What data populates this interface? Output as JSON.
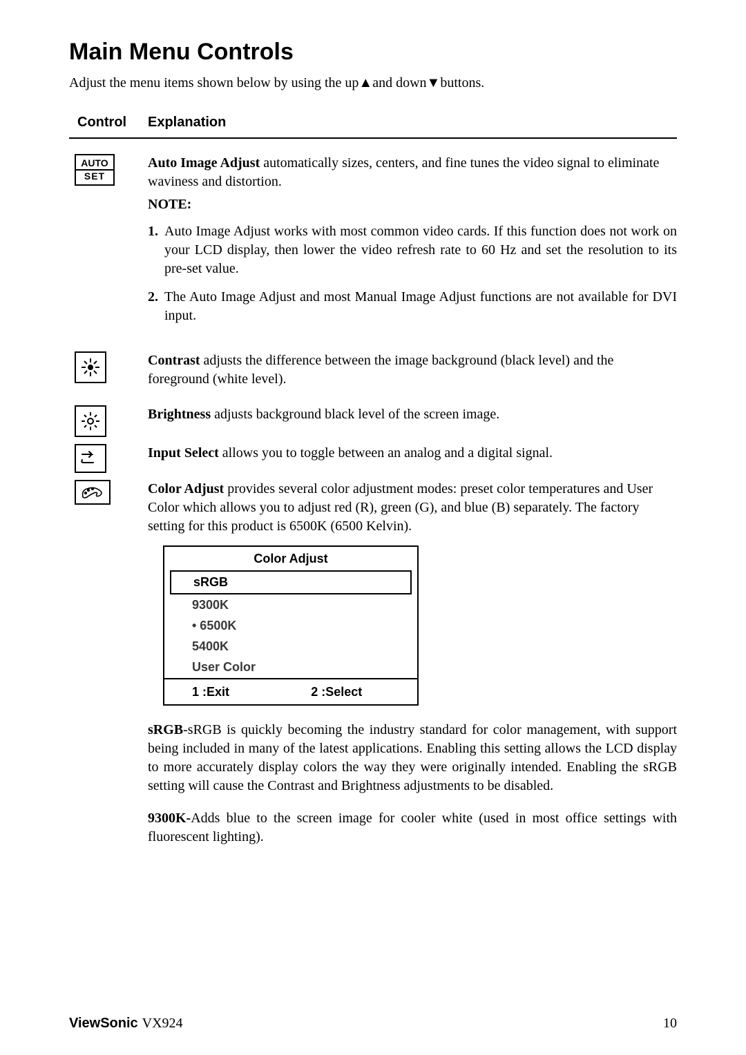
{
  "title": "Main Menu Controls",
  "intro_prefix": "Adjust the menu items shown below by using the up",
  "intro_mid": "and down",
  "intro_suffix": "buttons.",
  "header": {
    "control": "Control",
    "explanation": "Explanation"
  },
  "auto_set": {
    "l1": "AUTO",
    "l2": "SET"
  },
  "auto_image": {
    "lead": "Auto Image Adjust",
    "body": " automatically sizes, centers, and fine tunes the video signal to eliminate waviness and distortion.",
    "note": "NOTE:",
    "li1_num": "1.",
    "li1": "Auto Image Adjust works with most common video cards. If this function does not work on your LCD display, then lower the video refresh rate to 60 Hz and set the resolution to its pre-set value.",
    "li2_num": "2.",
    "li2": "The Auto Image Adjust and most Manual Image Adjust functions are not available for DVI input."
  },
  "contrast": {
    "lead": "Contrast",
    "body": " adjusts the difference between the image background  (black level) and the foreground (white level)."
  },
  "brightness": {
    "lead": "Brightness",
    "body": " adjusts background black level of the screen image."
  },
  "input_select": {
    "lead": "Input Select",
    "body": " allows you to toggle between an analog and a digital signal."
  },
  "color_adjust": {
    "lead": "Color Adjust",
    "body": " provides several color adjustment modes: preset color temperatures and User Color which allows you to adjust red (R), green (G), and blue (B) separately. The factory setting for this product is 6500K (6500 Kelvin)."
  },
  "panel": {
    "title": "Color Adjust",
    "i1": "sRGB",
    "i2": "9300K",
    "i3": "• 6500K",
    "i4": "5400K",
    "i5": "User Color",
    "exit": "1 :Exit",
    "select": "2 :Select"
  },
  "srgb": {
    "lead": "sRGB",
    "body": "-sRGB is quickly becoming the industry standard for color management, with support being included in many of the latest applications. Enabling this setting allows the LCD display to more accurately display colors the way they were originally intended. Enabling the sRGB setting will cause the Contrast and Brightness adjustments to be disabled."
  },
  "k9300": {
    "lead": "9300K-",
    "body": "Adds blue to the screen image for cooler white (used in most office settings with fluorescent lighting)."
  },
  "footer": {
    "brand": "ViewSonic",
    "model": "VX924",
    "page": "10"
  }
}
